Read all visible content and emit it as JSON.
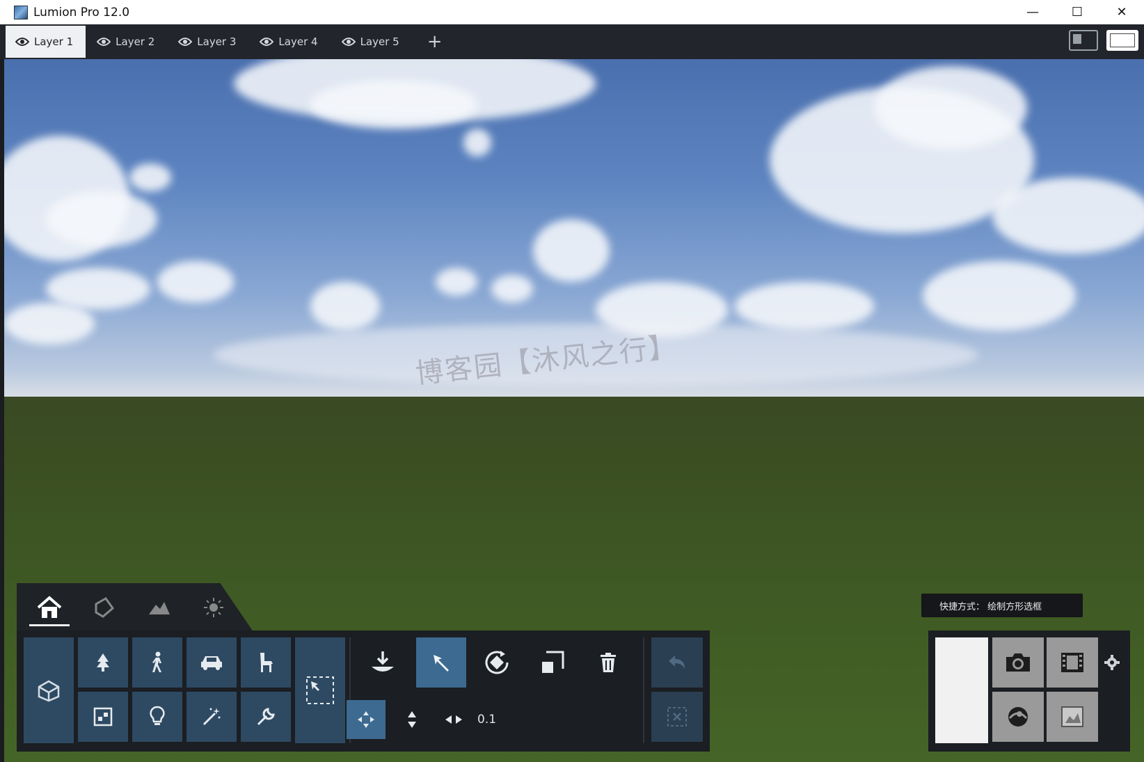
{
  "window": {
    "title": "Lumion Pro 12.0",
    "minimize": "—",
    "maximize": "☐",
    "close": "✕"
  },
  "layers": {
    "tabs": [
      {
        "label": "Layer 1",
        "active": true
      },
      {
        "label": "Layer 2",
        "active": false
      },
      {
        "label": "Layer 3",
        "active": false
      },
      {
        "label": "Layer 4",
        "active": false
      },
      {
        "label": "Layer 5",
        "active": false
      }
    ],
    "add_label": "+"
  },
  "viewport": {
    "watermark": "博客园【沐风之行】",
    "shortcut_hint": "快捷方式：  绘制方形选框"
  },
  "toolbox": {
    "mode_tabs": [
      "home-icon",
      "material-icon",
      "landscape-icon",
      "weather-icon"
    ],
    "objects": [
      "tree-icon",
      "person-icon",
      "car-icon",
      "chair-icon",
      "effects-icon",
      "light-icon",
      "magic-wand-icon",
      "wrench-icon"
    ],
    "value_field": "0.1"
  },
  "colors": {
    "tool_bg": "#2e4a63",
    "tool_selected": "#3d6a90",
    "panel_bg": "#1b1e22"
  }
}
